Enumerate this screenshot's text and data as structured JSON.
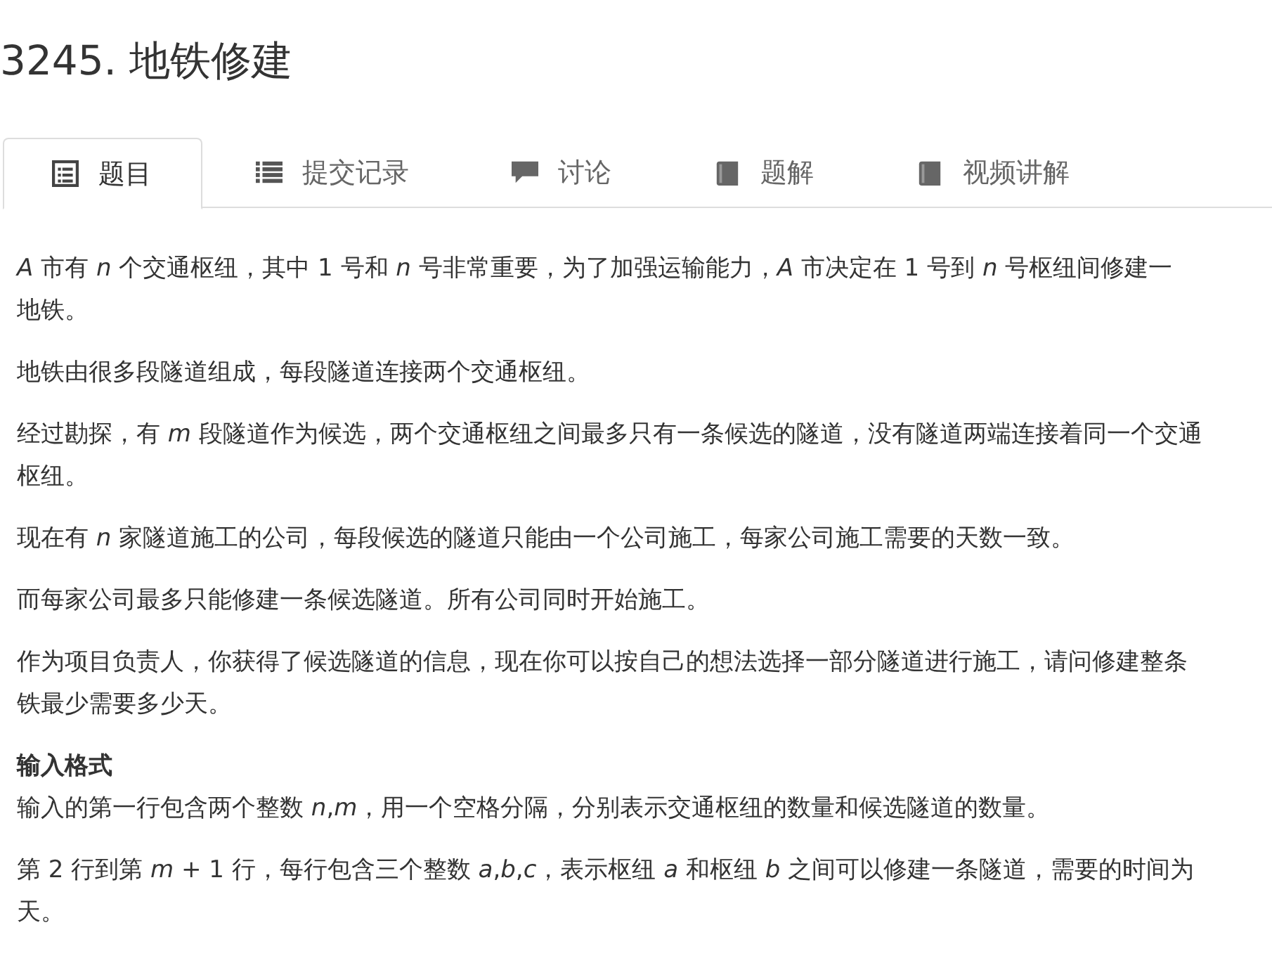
{
  "title": "3245. 地铁修建",
  "tabs": [
    {
      "label": "题目",
      "kind": "doc",
      "selected": true
    },
    {
      "label": "提交记录",
      "kind": "list",
      "selected": false
    },
    {
      "label": "讨论",
      "kind": "comment",
      "selected": false
    },
    {
      "label": "题解",
      "kind": "book",
      "selected": false
    },
    {
      "label": "视频讲解",
      "kind": "book",
      "selected": false
    }
  ],
  "content": [
    {
      "kind": "paragraph",
      "lines": [
        "*A* 市有 *n* 个交通枢纽，其中 1 号和 *n* 号非常重要，为了加强运输能力，*A* 市决定在 1 号到 *n* 号枢纽间修建一",
        "地铁。"
      ]
    },
    {
      "kind": "paragraph",
      "lines": [
        "地铁由很多段隧道组成，每段隧道连接两个交通枢纽。"
      ]
    },
    {
      "kind": "paragraph",
      "lines": [
        "经过勘探，有 *m* 段隧道作为候选，两个交通枢纽之间最多只有一条候选的隧道，没有隧道两端连接着同一个交通",
        "枢纽。"
      ]
    },
    {
      "kind": "paragraph",
      "lines": [
        "现在有 *n* 家隧道施工的公司，每段候选的隧道只能由一个公司施工，每家公司施工需要的天数一致。"
      ]
    },
    {
      "kind": "paragraph",
      "lines": [
        "而每家公司最多只能修建一条候选隧道。所有公司同时开始施工。"
      ]
    },
    {
      "kind": "paragraph",
      "lines": [
        "作为项目负责人，你获得了候选隧道的信息，现在你可以按自己的想法选择一部分隧道进行施工，请问修建整条",
        "铁最少需要多少天。"
      ]
    },
    {
      "kind": "heading",
      "lines": [
        "输入格式"
      ]
    },
    {
      "kind": "paragraph",
      "lines": [
        "输入的第一行包含两个整数 *n*,*m*，用一个空格分隔，分别表示交通枢纽的数量和候选隧道的数量。"
      ]
    },
    {
      "kind": "paragraph",
      "lines": [
        "第 2 行到第 *m* + 1 行，每行包含三个整数 *a*,*b*,*c*，表示枢纽 *a* 和枢纽 *b* 之间可以修建一条隧道，需要的时间为",
        "天。"
      ]
    }
  ]
}
